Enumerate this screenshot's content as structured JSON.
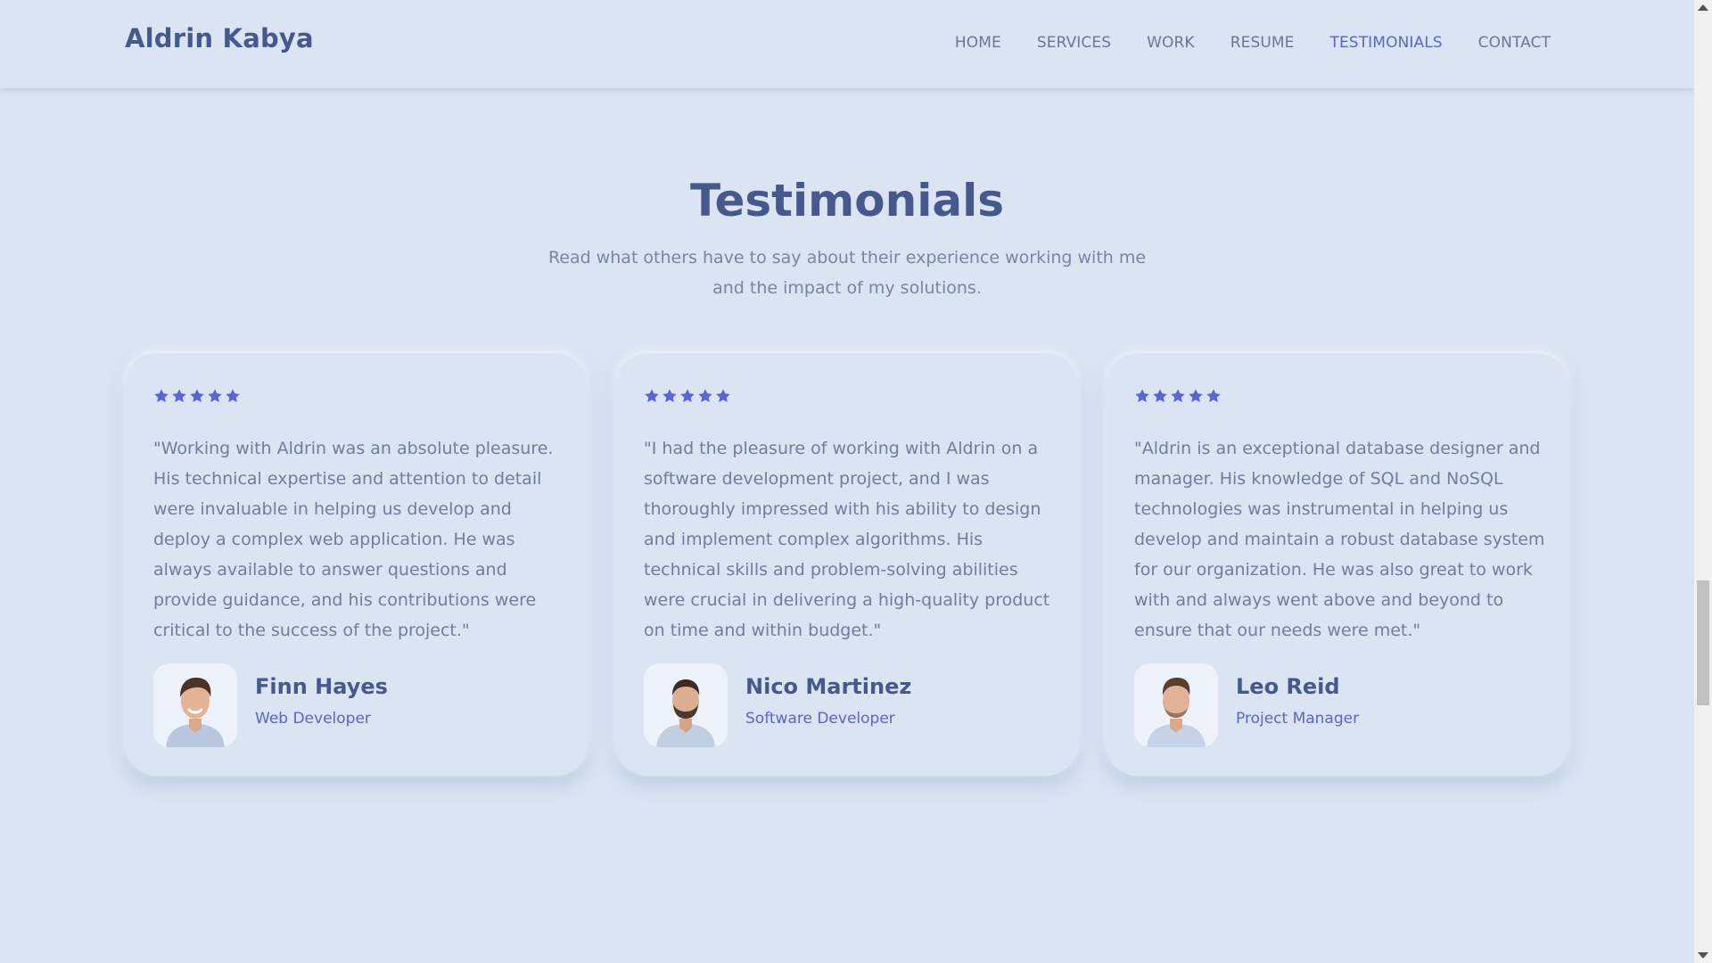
{
  "header": {
    "logo": "Aldrin Kabya",
    "nav": [
      {
        "label": "HOME",
        "active": false
      },
      {
        "label": "SERVICES",
        "active": false
      },
      {
        "label": "WORK",
        "active": false
      },
      {
        "label": "RESUME",
        "active": false
      },
      {
        "label": "TESTIMONIALS",
        "active": true
      },
      {
        "label": "CONTACT",
        "active": false
      }
    ]
  },
  "section": {
    "title": "Testimonials",
    "subtitle": "Read what others have to say about their experience working with me and the impact of my solutions."
  },
  "testimonials": [
    {
      "rating": 5,
      "quote": "\"Working with Aldrin was an absolute pleasure. His technical expertise and attention to detail were invaluable in helping us develop and deploy a complex web application. He was always available to answer questions and provide guidance, and his contributions were critical to the success of the project.\"",
      "name": "Finn Hayes",
      "role": "Web Developer",
      "avatar_icon": "avatar-photo"
    },
    {
      "rating": 5,
      "quote": "\"I had the pleasure of working with Aldrin on a software development project, and I was thoroughly impressed with his ability to design and implement complex algorithms. His technical skills and problem-solving abilities were crucial in delivering a high-quality product on time and within budget.\"",
      "name": "Nico Martinez",
      "role": "Software Developer",
      "avatar_icon": "avatar-photo"
    },
    {
      "rating": 5,
      "quote": "\"Aldrin is an exceptional database designer and manager. His knowledge of SQL and NoSQL technologies was instrumental in helping us develop and maintain a robust database system for our organization. He was also great to work with and always went above and beyond to ensure that our needs were met.\"",
      "name": "Leo Reid",
      "role": "Project Manager",
      "avatar_icon": "avatar-photo"
    }
  ],
  "colors": {
    "background": "#dae4f2",
    "heading": "#46598c",
    "accent": "#5a63d8",
    "body_text": "#717d9c",
    "star": "#5a63d8"
  },
  "scroll": {
    "position_fraction": 0.7
  }
}
